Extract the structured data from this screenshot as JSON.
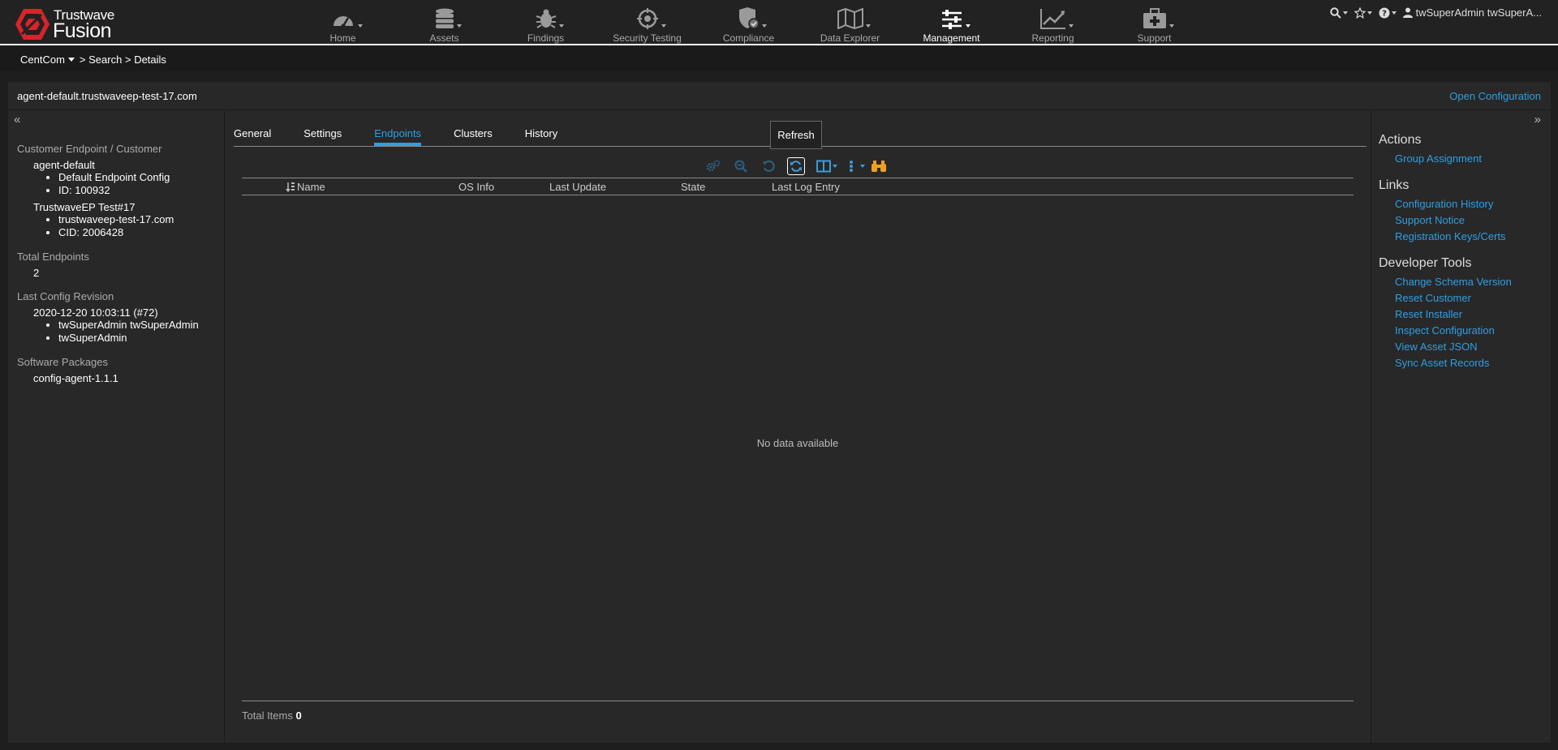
{
  "brand": {
    "line1": "Trustwave",
    "reg": "®",
    "line2": "Fusion"
  },
  "nav": [
    {
      "label": "Home"
    },
    {
      "label": "Assets"
    },
    {
      "label": "Findings"
    },
    {
      "label": "Security Testing"
    },
    {
      "label": "Compliance"
    },
    {
      "label": "Data Explorer"
    },
    {
      "label": "Management"
    },
    {
      "label": "Reporting"
    },
    {
      "label": "Support"
    }
  ],
  "user": {
    "name": "twSuperAdmin twSuperA..."
  },
  "breadcrumb": {
    "root": "CentCom",
    "sep1": ">",
    "search": "Search",
    "sep2": ">",
    "details": "Details"
  },
  "title": "agent-default.trustwaveep-test-17.com",
  "open_config": "Open Configuration",
  "left": {
    "sect1": "Customer Endpoint / Customer",
    "endpoint_name": "agent-default",
    "endpoint_items": [
      "Default Endpoint Config",
      "ID: 100932"
    ],
    "customer_name": "TrustwaveEP Test#17",
    "customer_items": [
      "trustwaveep-test-17.com",
      "CID: 2006428"
    ],
    "sect2": "Total Endpoints",
    "total": "2",
    "sect3": "Last Config Revision",
    "revision": "2020-12-20 10:03:11 (#72)",
    "revision_items": [
      "twSuperAdmin twSuperAdmin",
      "twSuperAdmin"
    ],
    "sect4": "Software Packages",
    "package": "config-agent-1.1.1"
  },
  "tabs": [
    "General",
    "Settings",
    "Endpoints",
    "Clusters",
    "History"
  ],
  "tooltip": "Refresh",
  "columns": [
    "Name",
    "OS Info",
    "Last Update",
    "State",
    "Last Log Entry"
  ],
  "empty": "No data available",
  "footer": {
    "label": "Total Items",
    "count": "0"
  },
  "right": {
    "actions_title": "Actions",
    "actions": [
      "Group Assignment"
    ],
    "links_title": "Links",
    "links": [
      "Configuration History",
      "Support Notice",
      "Registration Keys/Certs"
    ],
    "dev_title": "Developer Tools",
    "dev": [
      "Change Schema Version",
      "Reset Customer",
      "Reset Installer",
      "Inspect Configuration",
      "View Asset JSON",
      "Sync Asset Records"
    ]
  },
  "colors": {
    "accent": "#2f9ee3",
    "brand_red": "#d8232a",
    "binoculars": "#f0a020"
  }
}
